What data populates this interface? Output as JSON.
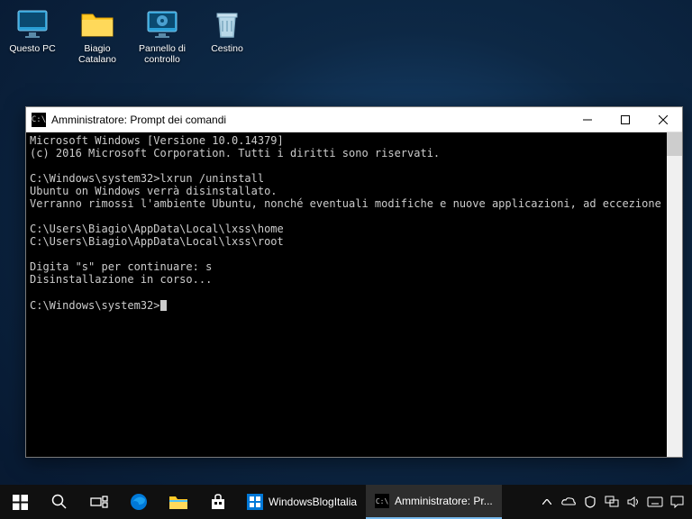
{
  "desktop": {
    "icons": [
      {
        "label": "Questo PC"
      },
      {
        "label": "Biagio Catalano"
      },
      {
        "label": "Pannello di controllo"
      },
      {
        "label": "Cestino"
      }
    ]
  },
  "window": {
    "title": "Amministratore: Prompt dei comandi",
    "lines": [
      "Microsoft Windows [Versione 10.0.14379]",
      "(c) 2016 Microsoft Corporation. Tutti i diritti sono riservati.",
      "",
      "C:\\Windows\\system32>lxrun /uninstall",
      "Ubuntu on Windows verrà disinstallato.",
      "Verranno rimossi l'ambiente Ubuntu, nonché eventuali modifiche e nuove applicazioni, ad eccezione di:",
      "",
      "C:\\Users\\Biagio\\AppData\\Local\\lxss\\home",
      "C:\\Users\\Biagio\\AppData\\Local\\lxss\\root",
      "",
      "Digita \"s\" per continuare: s",
      "Disinstallazione in corso...",
      "",
      "C:\\Windows\\system32>"
    ]
  },
  "taskbar": {
    "items": [
      {
        "label": "WindowsBlogItalia"
      },
      {
        "label": "Amministratore: Pr..."
      }
    ]
  }
}
